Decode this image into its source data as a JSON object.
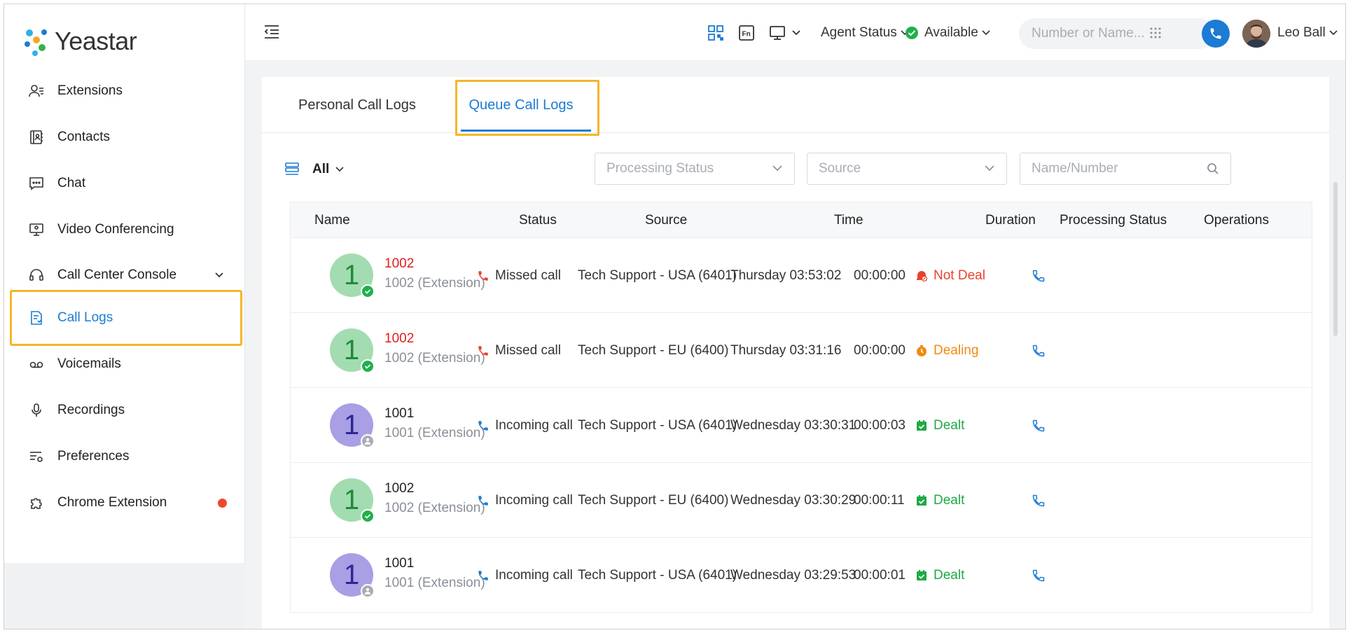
{
  "brand": {
    "name": "Yeastar"
  },
  "sidebar": {
    "items": [
      {
        "label": "Extensions",
        "icon": "user-list-icon"
      },
      {
        "label": "Contacts",
        "icon": "contacts-book-icon"
      },
      {
        "label": "Chat",
        "icon": "chat-bubble-icon"
      },
      {
        "label": "Video Conferencing",
        "icon": "monitor-icon"
      },
      {
        "label": "Call Center Console",
        "icon": "headset-icon"
      },
      {
        "label": "Call Logs",
        "icon": "call-log-icon"
      },
      {
        "label": "Voicemails",
        "icon": "voicemail-icon"
      },
      {
        "label": "Recordings",
        "icon": "microphone-icon"
      },
      {
        "label": "Preferences",
        "icon": "settings-list-icon"
      },
      {
        "label": "Chrome Extension",
        "icon": "puzzle-icon"
      }
    ],
    "active": "Call Logs"
  },
  "topbar": {
    "agent_status_label": "Agent Status",
    "availability_label": "Available",
    "search_placeholder": "Number or Name...",
    "user_name": "Leo Ball"
  },
  "tabs": {
    "personal": "Personal Call Logs",
    "queue": "Queue Call Logs",
    "active": "Queue Call Logs"
  },
  "filters": {
    "all_label": "All",
    "processing_status_placeholder": "Processing Status",
    "source_placeholder": "Source",
    "name_number_placeholder": "Name/Number"
  },
  "table": {
    "columns": [
      "Name",
      "Status",
      "Source",
      "Time",
      "Duration",
      "Processing Status",
      "Operations"
    ],
    "rows": [
      {
        "initial": "1",
        "avatar_color": "green",
        "badge": "check",
        "name": "1002",
        "name_color": "red",
        "sub": "1002 (Extension)",
        "status": "Missed call",
        "status_type": "missed",
        "source": "Tech Support - USA (6401)",
        "time": "Thursday 03:53:02",
        "duration": "00:00:00",
        "processing": "Not Deal",
        "processing_type": "notdeal"
      },
      {
        "initial": "1",
        "avatar_color": "green",
        "badge": "check",
        "name": "1002",
        "name_color": "red",
        "sub": "1002 (Extension)",
        "status": "Missed call",
        "status_type": "missed",
        "source": "Tech Support - EU (6400)",
        "time": "Thursday 03:31:16",
        "duration": "00:00:00",
        "processing": "Dealing",
        "processing_type": "dealing"
      },
      {
        "initial": "1",
        "avatar_color": "purple",
        "badge": "user",
        "name": "1001",
        "name_color": "dark",
        "sub": "1001 (Extension)",
        "status": "Incoming call",
        "status_type": "incoming",
        "source": "Tech Support - USA (6401)",
        "time": "Wednesday 03:30:31",
        "duration": "00:00:03",
        "processing": "Dealt",
        "processing_type": "dealt"
      },
      {
        "initial": "1",
        "avatar_color": "green",
        "badge": "check",
        "name": "1002",
        "name_color": "dark",
        "sub": "1002 (Extension)",
        "status": "Incoming call",
        "status_type": "incoming",
        "source": "Tech Support - EU (6400)",
        "time": "Wednesday 03:30:29",
        "duration": "00:00:11",
        "processing": "Dealt",
        "processing_type": "dealt"
      },
      {
        "initial": "1",
        "avatar_color": "purple",
        "badge": "user",
        "name": "1001",
        "name_color": "dark",
        "sub": "1001 (Extension)",
        "status": "Incoming call",
        "status_type": "incoming",
        "source": "Tech Support - USA (6401)",
        "time": "Wednesday 03:29:53",
        "duration": "00:00:01",
        "processing": "Dealt",
        "processing_type": "dealt"
      }
    ]
  },
  "colors": {
    "accent": "#1c7bd4",
    "highlight_border": "#f5b52a",
    "missed": "#e8432d",
    "dealing": "#f08a12",
    "dealt": "#20a945"
  }
}
